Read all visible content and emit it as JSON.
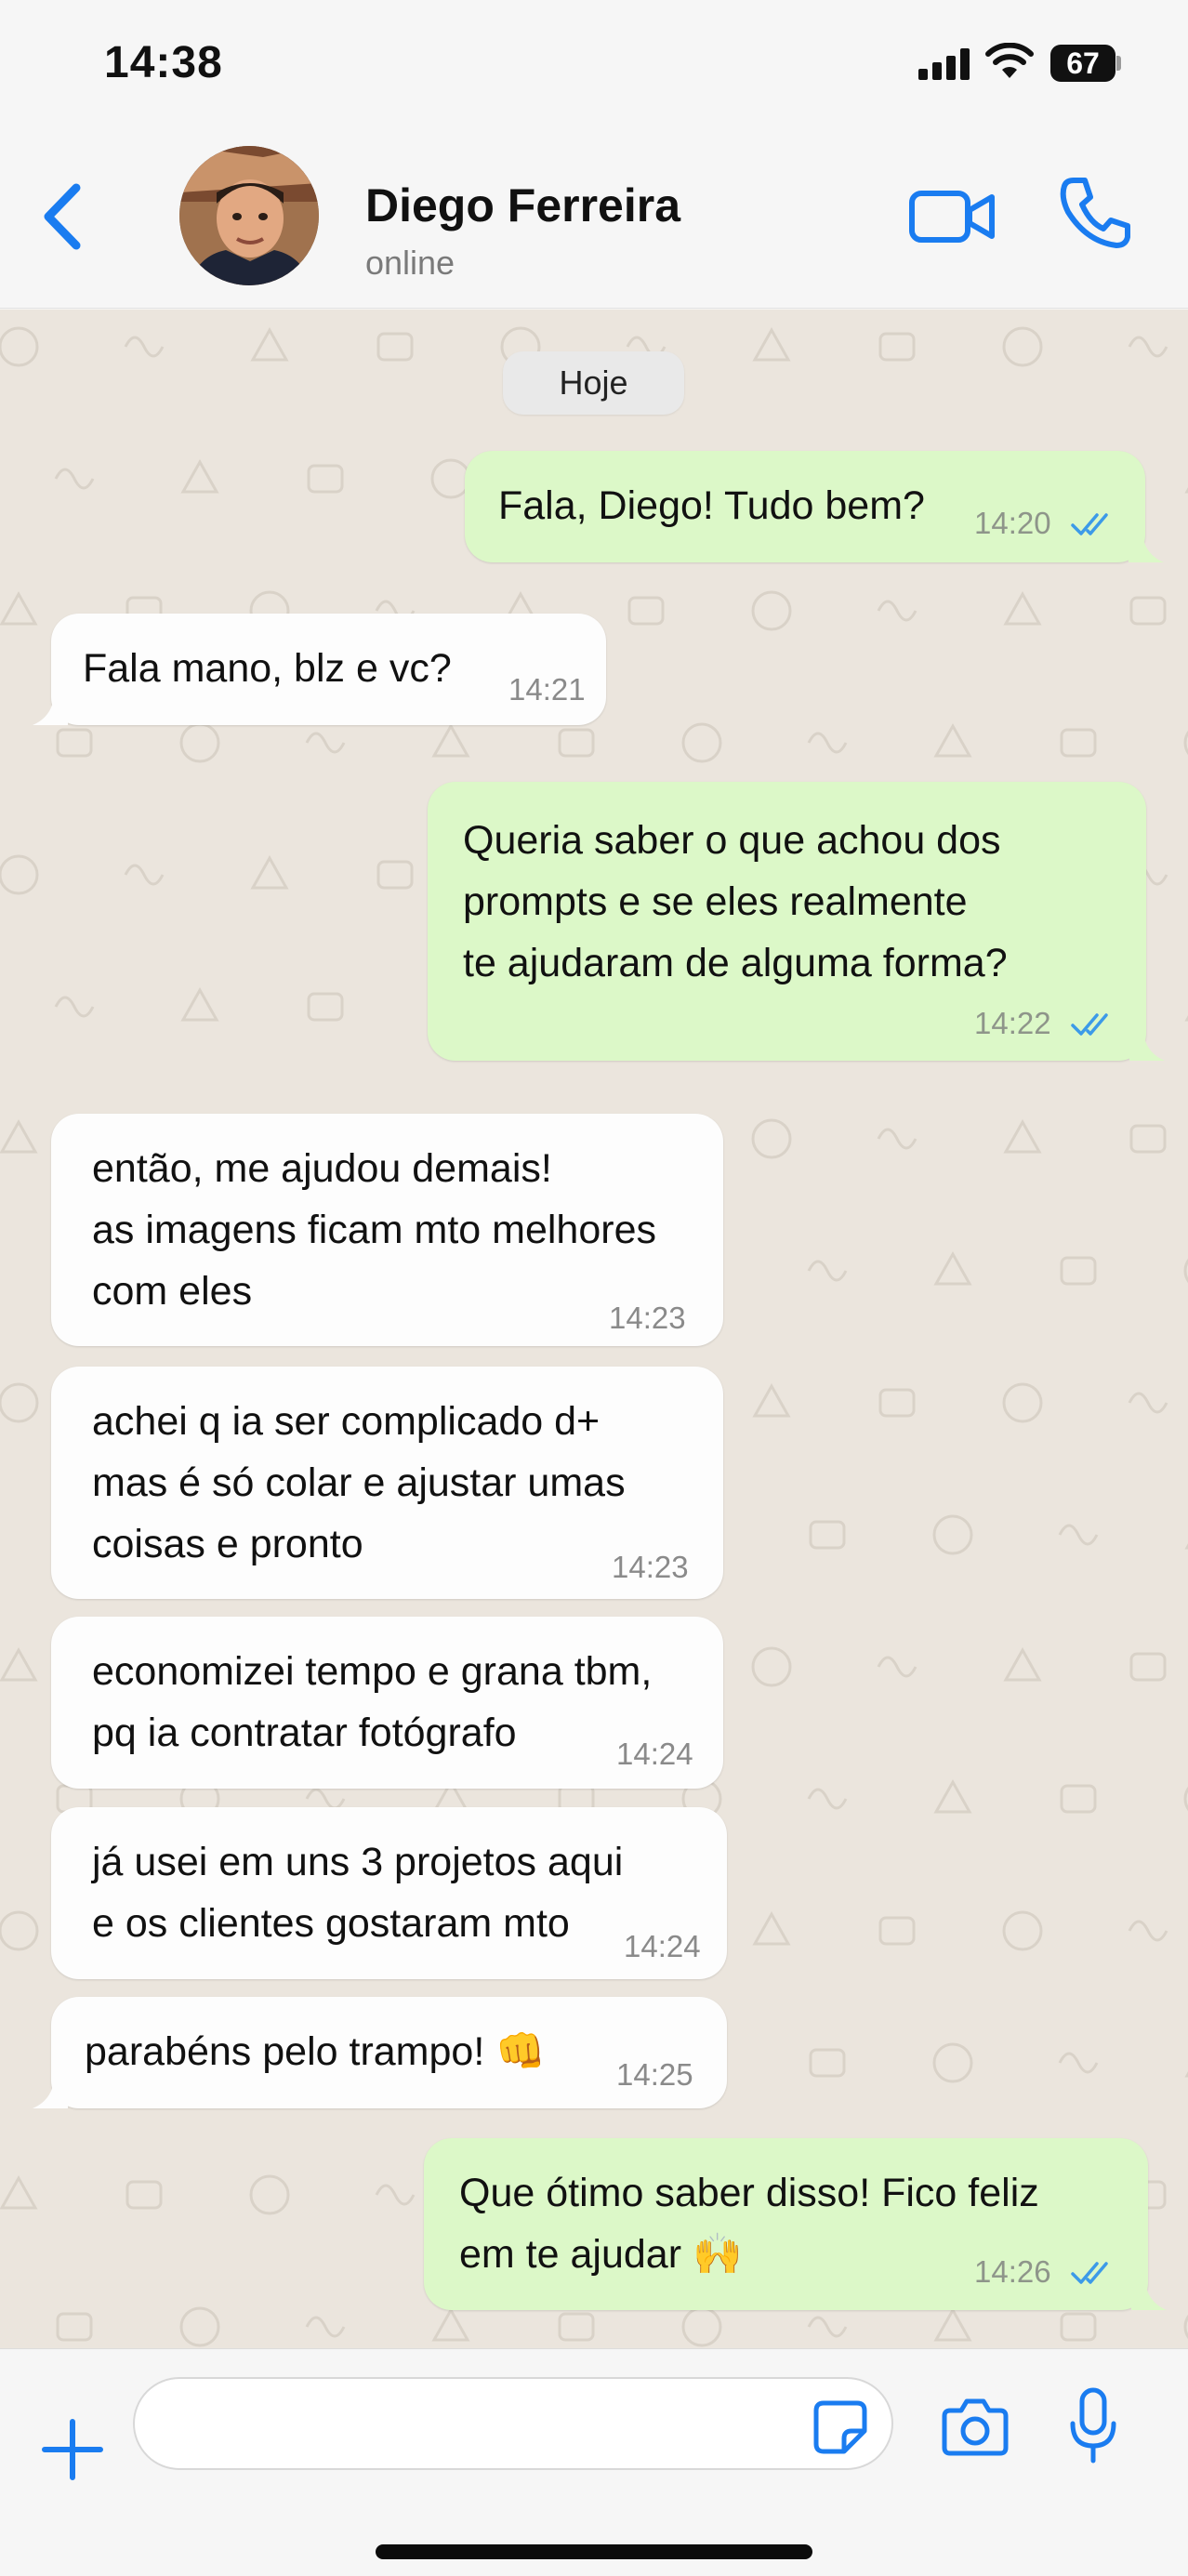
{
  "status_bar": {
    "time": "14:38",
    "battery": "67"
  },
  "header": {
    "contact_name": "Diego Ferreira",
    "contact_status": "online"
  },
  "chat": {
    "date_chip": "Hoje",
    "messages": [
      {
        "direction": "out",
        "text": "Fala, Diego! Tudo bem?",
        "time": "14:20",
        "read": true
      },
      {
        "direction": "in",
        "text": "Fala mano, blz e vc?",
        "time": "14:21"
      },
      {
        "direction": "out",
        "text": "Queria saber o que achou dos\nprompts e se eles realmente\nte ajudaram de alguma forma?",
        "time": "14:22",
        "read": true
      },
      {
        "direction": "in",
        "text": "então, me ajudou demais!\nas imagens ficam mto melhores\ncom eles",
        "time": "14:23"
      },
      {
        "direction": "in",
        "text": "achei q ia ser complicado d+\nmas é só colar e ajustar umas\ncoisas e pronto",
        "time": "14:23"
      },
      {
        "direction": "in",
        "text": "economizei tempo e grana tbm,\npq ia contratar fotógrafo",
        "time": "14:24"
      },
      {
        "direction": "in",
        "text": "já usei em uns 3 projetos aqui\ne os clientes gostaram mto",
        "time": "14:24"
      },
      {
        "direction": "in",
        "text": "parabéns pelo trampo! 👊",
        "time": "14:25"
      },
      {
        "direction": "out",
        "text": "Que ótimo saber disso! Fico feliz\nem te ajudar 🙌",
        "time": "14:26",
        "read": true
      }
    ]
  },
  "input_bar": {
    "placeholder": ""
  },
  "icons": {
    "back": "chevron-left-icon",
    "video_call": "video-camera-icon",
    "voice_call": "phone-icon",
    "attach": "plus-icon",
    "sticker": "sticker-icon",
    "camera": "camera-icon",
    "mic": "microphone-icon",
    "read_receipt": "double-check-icon"
  },
  "colors": {
    "accent": "#1a7cf0",
    "outgoing_bubble": "#dcf8c8",
    "incoming_bubble": "#fdfdfd",
    "chat_background": "#ebe5dd",
    "read_tick": "#3c9ae8"
  }
}
